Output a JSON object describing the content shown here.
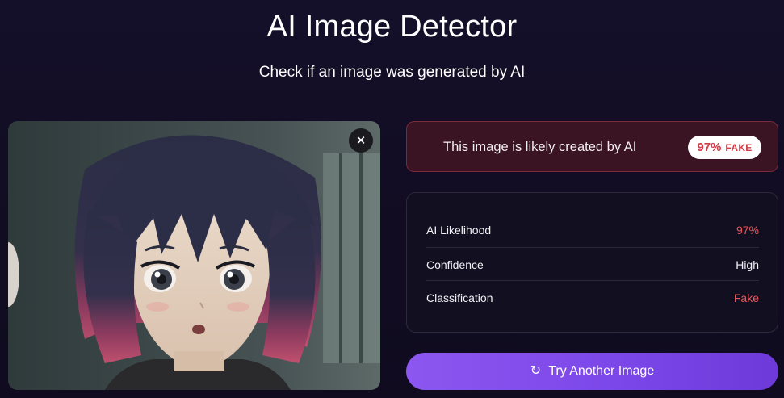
{
  "header": {
    "title": "AI Image Detector",
    "subtitle": "Check if an image was generated by AI"
  },
  "image_panel": {
    "close_icon": "close-icon",
    "close_glyph": "✕"
  },
  "verdict": {
    "text": "This image is likely created by AI",
    "percent": "97%",
    "label": "FAKE",
    "color": "#d23a45"
  },
  "stats": {
    "rows": [
      {
        "label": "AI Likelihood",
        "value": "97%"
      },
      {
        "label": "Confidence",
        "value": "High"
      },
      {
        "label": "Classification",
        "value": "Fake"
      }
    ]
  },
  "action": {
    "label": "Try Another Image",
    "icon": "refresh-icon",
    "icon_glyph": "↻"
  },
  "colors": {
    "accent": "#7b46e8",
    "danger": "#e5565d",
    "background": "#120d24"
  }
}
